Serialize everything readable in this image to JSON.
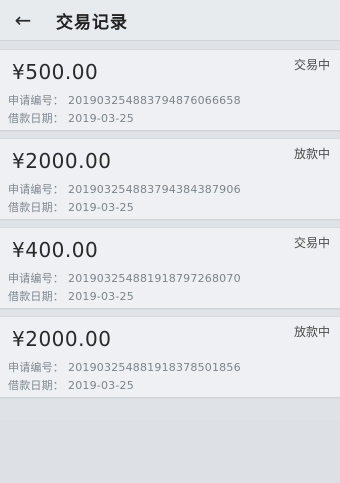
{
  "header": {
    "back_icon": "back-arrow-icon",
    "title": "交易记录"
  },
  "labels": {
    "app_no": "申请编号：",
    "loan_date": "借款日期："
  },
  "records": [
    {
      "amount": "¥500.00",
      "status": "交易中",
      "app_no": "20190325488379487606665​8",
      "date": "2019-03-25"
    },
    {
      "amount": "¥2000.00",
      "status": "放款中",
      "app_no": "20190325488379438438790​6",
      "date": "2019-03-25"
    },
    {
      "amount": "¥400.00",
      "status": "交易中",
      "app_no": "20190325488191879726807​0",
      "date": "2019-03-25"
    },
    {
      "amount": "¥2000.00",
      "status": "放款中",
      "app_no": "20190325488191837850185​6",
      "date": "2019-03-25"
    }
  ]
}
